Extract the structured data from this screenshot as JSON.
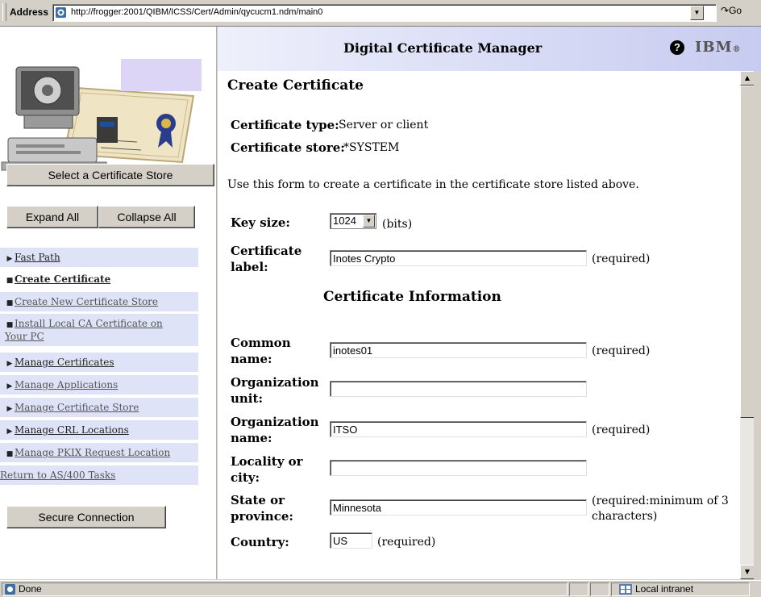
{
  "browser": {
    "address_label": "Address",
    "url": "http://frogger:2001/QIBM/ICSS/Cert/Admin/qycucm1.ndm/main0",
    "go_label": "Go",
    "status_text": "Done",
    "zone_text": "Local intranet"
  },
  "header": {
    "title": "Digital Certificate Manager",
    "help_glyph": "?",
    "logo_text": "IBM",
    "logo_mark": "®"
  },
  "sidebar": {
    "select_store_button": "Select a Certificate Store",
    "expand_button": "Expand All",
    "collapse_button": "Collapse All",
    "items": [
      {
        "label": "Fast Path",
        "marker": "▶"
      },
      {
        "label": "Create Certificate",
        "marker": "■"
      },
      {
        "label": "Create New Certificate Store",
        "marker": "■"
      },
      {
        "label": "Install Local CA Certificate on Your PC",
        "marker": "■"
      },
      {
        "label": "Manage Certificates",
        "marker": "▶"
      },
      {
        "label": "Manage Applications",
        "marker": "▶"
      },
      {
        "label": "Manage Certificate Store",
        "marker": "▶"
      },
      {
        "label": "Manage CRL Locations",
        "marker": "▶"
      },
      {
        "label": "Manage PKIX Request Location",
        "marker": "■"
      },
      {
        "label": "Return to AS/400 Tasks",
        "marker": ""
      }
    ],
    "secure_button": "Secure Connection"
  },
  "main": {
    "heading": "Create Certificate",
    "type_label": "Certificate type:",
    "type_value": "Server or client",
    "store_label": "Certificate store:",
    "store_value": "*SYSTEM",
    "intro": "Use this form to create a certificate in the certificate store listed above.",
    "key_size_label": "Key size:",
    "key_size_value": "1024",
    "key_size_unit": "(bits)",
    "cert_label_label": "Certificate label:",
    "cert_label_value": "Inotes Crypto",
    "required": "(required)",
    "section_title": "Certificate Information",
    "fields": {
      "common_name": {
        "label": "Common name:",
        "value": "inotes01"
      },
      "org_unit": {
        "label": "Organization unit:",
        "value": ""
      },
      "org_name": {
        "label": "Organization name:",
        "value": "ITSO"
      },
      "locality": {
        "label": "Locality or city:",
        "value": ""
      },
      "state": {
        "label": "State or province:",
        "value": "Minnesota",
        "note": "(required:minimum of 3 characters)"
      },
      "country": {
        "label": "Country:",
        "value": "US"
      }
    }
  }
}
